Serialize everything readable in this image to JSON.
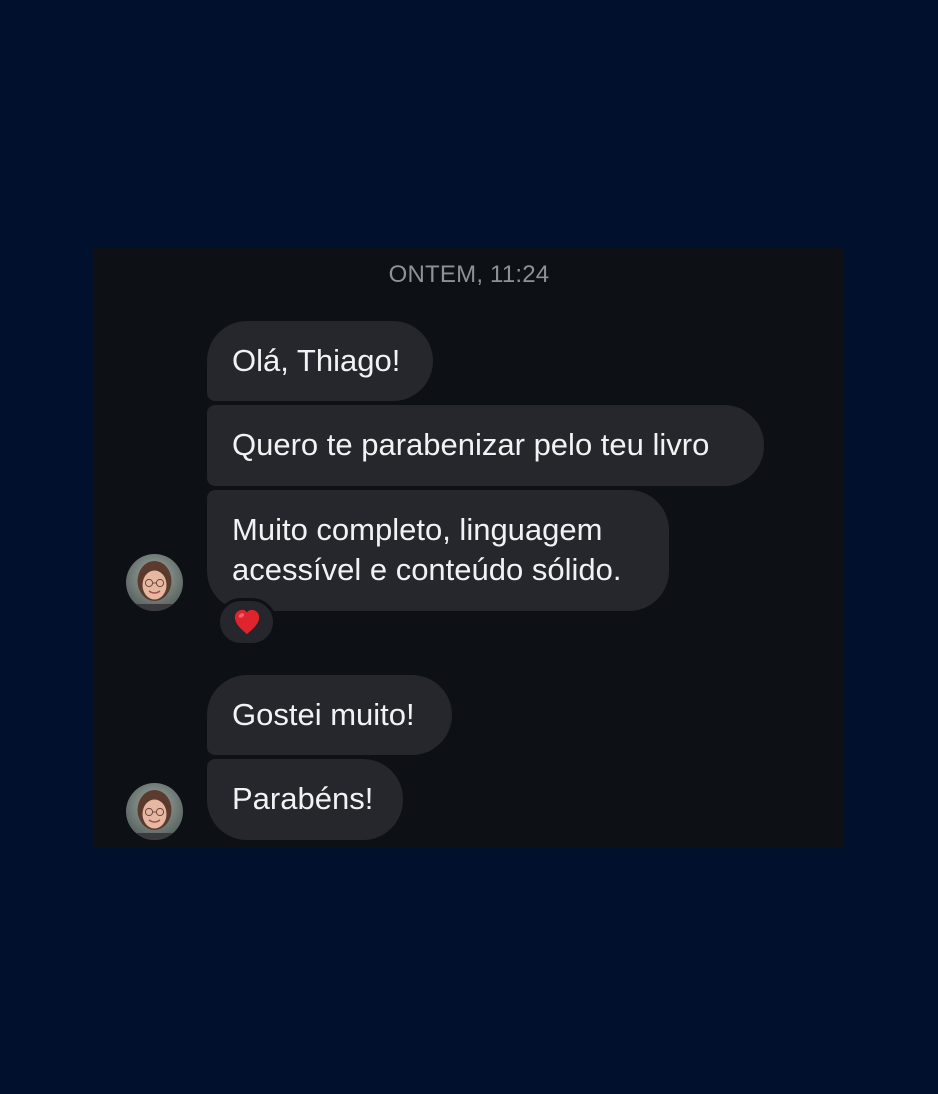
{
  "theme": {
    "page_background": "#00102d",
    "panel_background": "#0d1015",
    "bubble_background": "#25272c",
    "bubble_text": "#f1f2f4",
    "timestamp_text": "#8e9198",
    "reaction_color": "#e0242e"
  },
  "chat": {
    "timestamp": "ONTEM, 11:24",
    "messages": [
      {
        "text": "Olá, Thiago!"
      },
      {
        "text": "Quero te parabenizar pelo teu livro"
      },
      {
        "lines": [
          "Muito completo, linguagem",
          "acessível e conteúdo sólido."
        ],
        "reaction": "heart-icon"
      },
      {
        "text": "Gostei muito!"
      },
      {
        "text": "Parabéns!"
      }
    ]
  }
}
